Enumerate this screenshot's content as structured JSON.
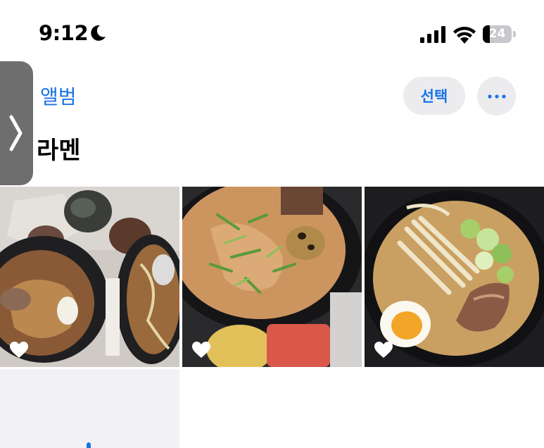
{
  "status": {
    "time": "9:12",
    "battery_level": "24",
    "battery_fraction": 0.24
  },
  "nav": {
    "back_label": "앨범",
    "select_label": "선택",
    "more_icon": "ellipsis-icon"
  },
  "album": {
    "title": "라멘"
  },
  "photos": [
    {
      "subject": "ramen-with-onigiri",
      "favorited": true
    },
    {
      "subject": "ramen-bowl-green-onion",
      "favorited": true
    },
    {
      "subject": "ramen-with-egg-chashu",
      "favorited": true
    }
  ],
  "colors": {
    "accent": "#1a73e8",
    "button_bg": "#ececee"
  }
}
